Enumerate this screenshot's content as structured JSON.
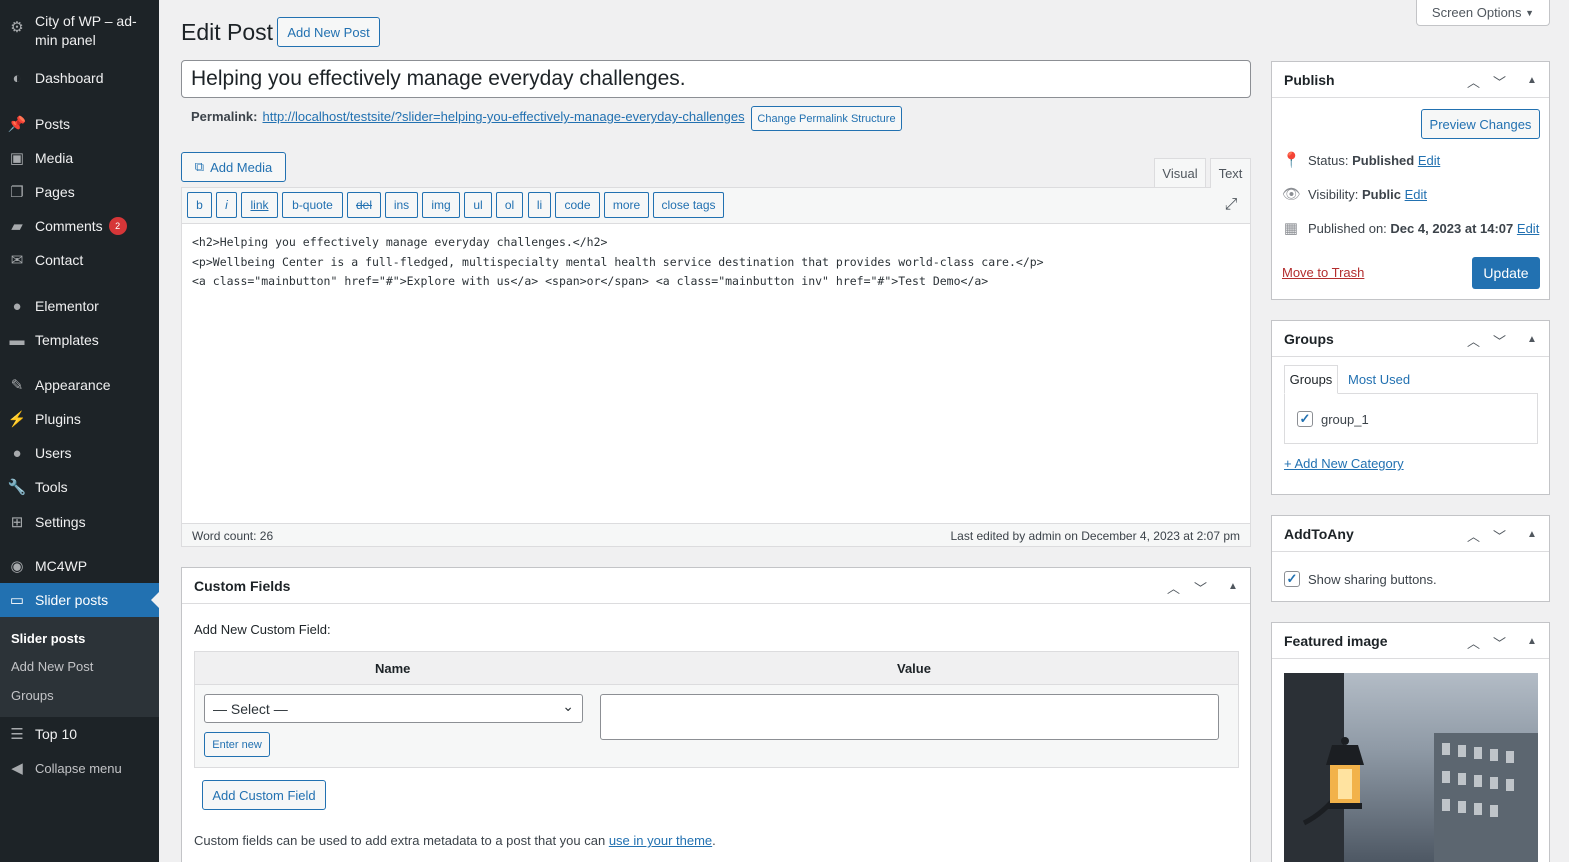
{
  "sidebar": {
    "site": "City of WP – ad-min panel",
    "items": [
      {
        "label": "Dashboard",
        "icon": "dashboard-icon"
      },
      {
        "label": "Posts",
        "icon": "pin-icon"
      },
      {
        "label": "Media",
        "icon": "media-icon"
      },
      {
        "label": "Pages",
        "icon": "pages-icon"
      },
      {
        "label": "Comments",
        "icon": "comment-icon",
        "badge": "2"
      },
      {
        "label": "Contact",
        "icon": "mail-icon"
      },
      {
        "label": "Elementor",
        "icon": "elementor-icon"
      },
      {
        "label": "Templates",
        "icon": "folder-icon"
      },
      {
        "label": "Appearance",
        "icon": "brush-icon"
      },
      {
        "label": "Plugins",
        "icon": "plug-icon"
      },
      {
        "label": "Users",
        "icon": "user-icon"
      },
      {
        "label": "Tools",
        "icon": "wrench-icon"
      },
      {
        "label": "Settings",
        "icon": "settings-icon"
      },
      {
        "label": "MC4WP",
        "icon": "mc4wp-icon"
      },
      {
        "label": "Slider posts",
        "icon": "monitor-icon"
      },
      {
        "label": "Top 10",
        "icon": "list-icon"
      },
      {
        "label": "Collapse menu",
        "icon": "collapse-icon"
      }
    ],
    "submenu": [
      "Slider posts",
      "Add New Post",
      "Groups"
    ]
  },
  "header": {
    "title": "Edit Post",
    "add_new": "Add New Post",
    "screen_options": "Screen Options"
  },
  "post": {
    "title": "Helping you effectively manage everyday challenges.",
    "permalink_label": "Permalink:",
    "permalink_url": "http://localhost/testsite/?slider=helping-you-effectively-manage-everyday-challenges",
    "change_permalink": "Change Permalink Structure"
  },
  "editor": {
    "add_media": "Add Media",
    "tab_visual": "Visual",
    "tab_text": "Text",
    "quicktags": [
      "b",
      "i",
      "link",
      "b-quote",
      "del",
      "ins",
      "img",
      "ul",
      "ol",
      "li",
      "code",
      "more",
      "close tags"
    ],
    "lines": [
      "<h2>Helping you effectively manage everyday challenges.</h2>",
      "<p>Wellbeing Center is a full-fledged, multispecialty mental health service destination that provides world-class care.</p>",
      "<a class=\"mainbutton\" href=\"#\">Explore with us</a> <span>or</span> <a class=\"mainbutton inv\" href=\"#\">Test Demo</a>"
    ],
    "word_count": "Word count: 26",
    "last_edited": "Last edited by admin on December 4, 2023 at 2:07 pm"
  },
  "custom_fields": {
    "title": "Custom Fields",
    "add_new_label": "Add New Custom Field:",
    "col_name": "Name",
    "col_value": "Value",
    "select_value": "— Select —",
    "enter_new": "Enter new",
    "add_button": "Add Custom Field",
    "help_text": "Custom fields can be used to add extra metadata to a post that you can",
    "help_link": "use in your theme",
    "help_end": "."
  },
  "publish": {
    "title": "Publish",
    "preview": "Preview Changes",
    "status_label": "Status:",
    "status_value": "Published",
    "visibility_label": "Visibility:",
    "visibility_value": "Public",
    "published_label": "Published on:",
    "published_value": "Dec 4, 2023 at 14:07",
    "edit": "Edit",
    "trash": "Move to Trash",
    "update": "Update"
  },
  "groups": {
    "title": "Groups",
    "tab_all": "Groups",
    "tab_used": "Most Used",
    "item": "group_1",
    "add": "+ Add New Category"
  },
  "addtoany": {
    "title": "AddToAny",
    "checkbox": "Show sharing buttons."
  },
  "featured": {
    "title": "Featured image"
  }
}
